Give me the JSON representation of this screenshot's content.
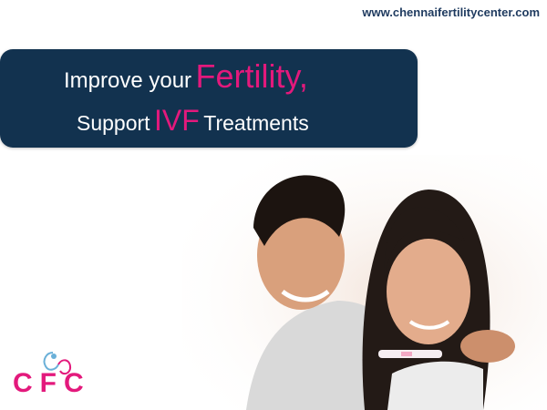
{
  "header": {
    "url": "www.chennaifertilitycenter.com"
  },
  "banner": {
    "line1_plain": "Improve your",
    "line1_highlight": "Fertility,",
    "line2_plain_start": "Support",
    "line2_highlight": "IVF",
    "line2_plain_end": "Treatments"
  },
  "logo": {
    "text": "CFC"
  },
  "colors": {
    "accent": "#e3197c",
    "banner": "#12324f",
    "url": "#1e3a5f"
  },
  "icons": {
    "logo_mark": "heart-swirl-icon"
  }
}
